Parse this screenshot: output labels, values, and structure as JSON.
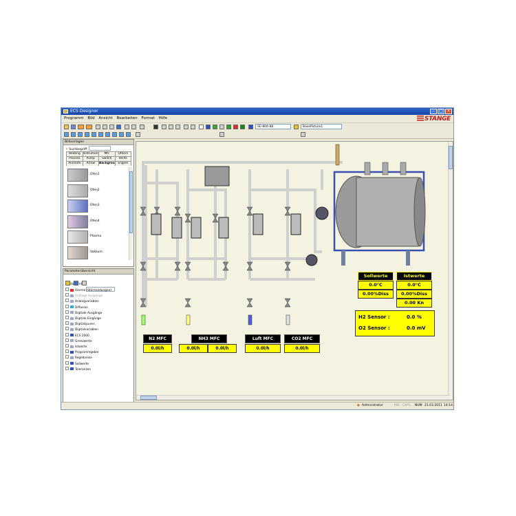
{
  "window": {
    "title": "ECS Designer"
  },
  "menu": [
    "Programm",
    "Bild",
    "Ansicht",
    "Bearbeiten",
    "Format",
    "Hilfe"
  ],
  "brand": {
    "logo_text": "STANGE",
    "color": "#c21b17"
  },
  "toolbar": {
    "item_field": "SE-804-88",
    "picture_field": "BasePicture1"
  },
  "bildvorlagen": {
    "title": "Bildvorlagen",
    "search_label": "Suchbegriff:",
    "tabs_row1": [
      "Heating",
      "Instruments",
      "Mfc",
      "Others"
    ],
    "tabs_row2": [
      "Process",
      "Pump",
      "Switch",
      "Vents"
    ],
    "tabs_row3": [
      "Animate",
      "Arrow",
      "Background",
      "Engine"
    ],
    "active_tab": "Background",
    "thumbnails": [
      "Ofen1",
      "Ofen2",
      "Ofen3",
      "Ofen4",
      "Plasma",
      "Vakkum"
    ]
  },
  "parameter": {
    "title": "Parameterübersicht",
    "search_label": "Suchbegriff:",
    "tree": [
      "Alarme (Störmeldungen)",
      "Analoge Ausgänge",
      "Analogvariablen",
      "Diffusion",
      "Digitale Ausgänge",
      "Digitale Eingänge",
      "Digitalspuren",
      "Digitalvariablen",
      "ECS 2000",
      "Grenzwerte",
      "Istwerte",
      "Programmgeber",
      "Regelkreise",
      "Sollwerte",
      "Toleranzen"
    ]
  },
  "process": {
    "mfcs": [
      {
        "label": "N2 MFC",
        "values": [
          "0.0l/h"
        ]
      },
      {
        "label": "NH3 MFC",
        "values": [
          "0.0l/h",
          "0.0l/h"
        ]
      },
      {
        "label": "Luft MFC",
        "values": [
          "0.0l/h"
        ]
      },
      {
        "label": "CO2 MFC",
        "values": [
          "0.0l/h"
        ]
      }
    ],
    "sollwerte": {
      "label": "Sollwerte",
      "values": [
        "0.0°C",
        "0.00%Diss"
      ]
    },
    "istwerte": {
      "label": "Istwerte",
      "values": [
        "0.0°C",
        "0.00%Diss",
        "0.00 Kn"
      ]
    },
    "sensors": [
      {
        "label": "H2 Sensor :",
        "value": "0.0 %"
      },
      {
        "label": "O2 Sensor :",
        "value": "0.0 mV"
      }
    ],
    "colors": {
      "display_bg": "#ffff00",
      "label_bg": "#000000",
      "pipe": "#d8d8d8",
      "vessel_frame": "#3a4fb0"
    }
  },
  "status": {
    "user": "Administrator",
    "ins": "INS",
    "caps": "CAPS",
    "num": "NUM",
    "date": "21.03.2011",
    "time": "14:14"
  }
}
